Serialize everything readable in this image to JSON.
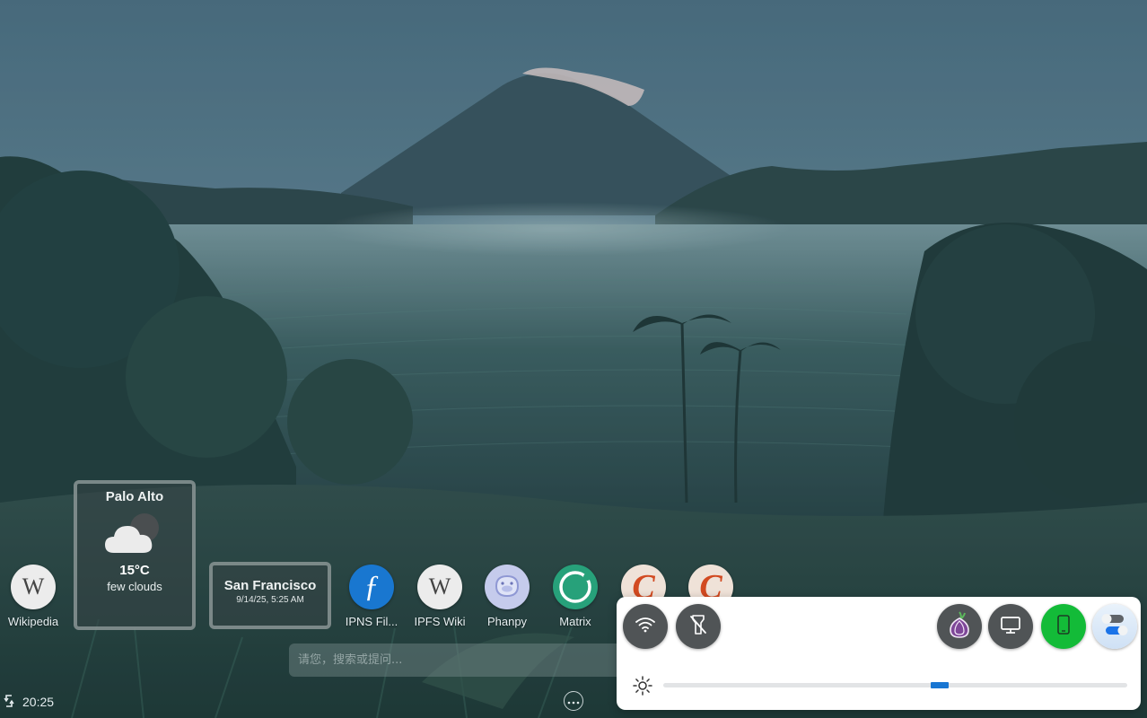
{
  "desktop": {
    "apps": [
      {
        "label": "Wikipedia",
        "icon": "wikipedia-icon"
      },
      {
        "label": "IPNS Fil...",
        "icon": "filecoin-icon"
      },
      {
        "label": "IPFS Wiki",
        "icon": "wikipedia-icon"
      },
      {
        "label": "Phanpy",
        "icon": "phanpy-icon"
      },
      {
        "label": "Matrix",
        "icon": "matrix-icon"
      },
      {
        "label": "",
        "icon": "c-app-icon"
      },
      {
        "label": "",
        "icon": "c-app-icon"
      }
    ],
    "icon_glyphs": {
      "wikipedia": "W",
      "filecoin": "ƒ",
      "c_app": "C"
    }
  },
  "weather": {
    "palo_alto": {
      "city": "Palo Alto",
      "temp": "15°C",
      "description": "few clouds",
      "icon": "cloud-night-icon"
    },
    "san_francisco": {
      "city": "San Francisco",
      "datetime": "9/14/25, 5:25 AM"
    }
  },
  "search": {
    "placeholder": "请您，搜索或提问..."
  },
  "taskbar": {
    "time": "20:25"
  },
  "quick_settings": {
    "left_buttons": [
      "wifi-icon",
      "flashlight-off-icon"
    ],
    "right_buttons": [
      "tor-icon",
      "desktop-mode-icon",
      "phone-mode-icon",
      "settings-toggle-icon"
    ],
    "active_color": "#13bb38",
    "slider_color": "#1976d2",
    "brightness_level": 0.6
  }
}
